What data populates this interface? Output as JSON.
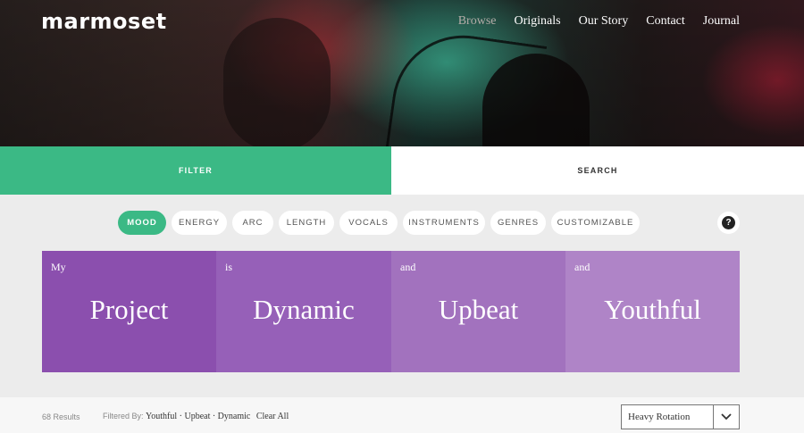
{
  "brand": {
    "logo": "marmoset"
  },
  "nav": [
    {
      "label": "Browse",
      "active": true
    },
    {
      "label": "Originals"
    },
    {
      "label": "Our Story"
    },
    {
      "label": "Contact"
    },
    {
      "label": "Journal"
    }
  ],
  "tabs": {
    "filter": "FILTER",
    "search": "SEARCH"
  },
  "categories": [
    {
      "label": "MOOD",
      "active": true
    },
    {
      "label": "ENERGY"
    },
    {
      "label": "ARC"
    },
    {
      "label": "LENGTH"
    },
    {
      "label": "VOCALS"
    },
    {
      "label": "INSTRUMENTS"
    },
    {
      "label": "GENRES"
    },
    {
      "label": "CUSTOMIZABLE"
    }
  ],
  "help": {
    "glyph": "?"
  },
  "sentence": [
    {
      "connector": "My",
      "word": "Project",
      "color": "#8b4fae"
    },
    {
      "connector": "is",
      "word": "Dynamic",
      "color": "#9660b8"
    },
    {
      "connector": "and",
      "word": "Upbeat",
      "color": "#a272be"
    },
    {
      "connector": "and",
      "word": "Youthful",
      "color": "#af84c7"
    }
  ],
  "results": {
    "count": "68 Results",
    "filtered_label": "Filtered By:",
    "filters_text": "Youthful · Upbeat · Dynamic",
    "clear": "Clear All"
  },
  "sort": {
    "value": "Heavy Rotation"
  },
  "colors": {
    "accent": "#3bb985",
    "purple": "#8b4fae"
  }
}
